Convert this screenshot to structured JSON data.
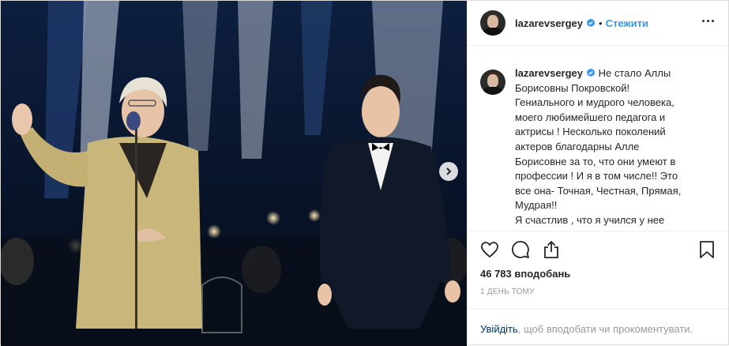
{
  "post": {
    "username": "lazarevsergey",
    "follow_label": "Стежити",
    "dot": "•",
    "more_label": "···",
    "caption_username": "lazarevsergey",
    "caption_lines": [
      "Не стало Аллы",
      "Борисовны Покровской!",
      "Гениального и мудрого человека,",
      "моего любимейшего педагога и",
      "актрисы ! Несколько поколений",
      "актеров благодарны Алле",
      "Борисовне за то, что они умеют в",
      "профессии ! И я в том числе!! Это",
      "все она- Точная, Честная, Прямая,",
      "Мудрая!!",
      "Я счастлив , что я учился у нее"
    ],
    "likes": "46 783 вподобань",
    "time": "1 ДЕНЬ ТОМУ",
    "login_link": "Увійдіть",
    "login_rest": ", щоб вподобати чи прокоментувати."
  },
  "icons": {
    "verified": "verified-badge-icon",
    "like": "heart-icon",
    "comment": "comment-icon",
    "share": "share-icon",
    "save": "bookmark-icon",
    "next": "chevron-right-icon"
  },
  "colors": {
    "accent": "#3897f0",
    "text": "#262626",
    "muted": "#999999",
    "link": "#003569"
  }
}
